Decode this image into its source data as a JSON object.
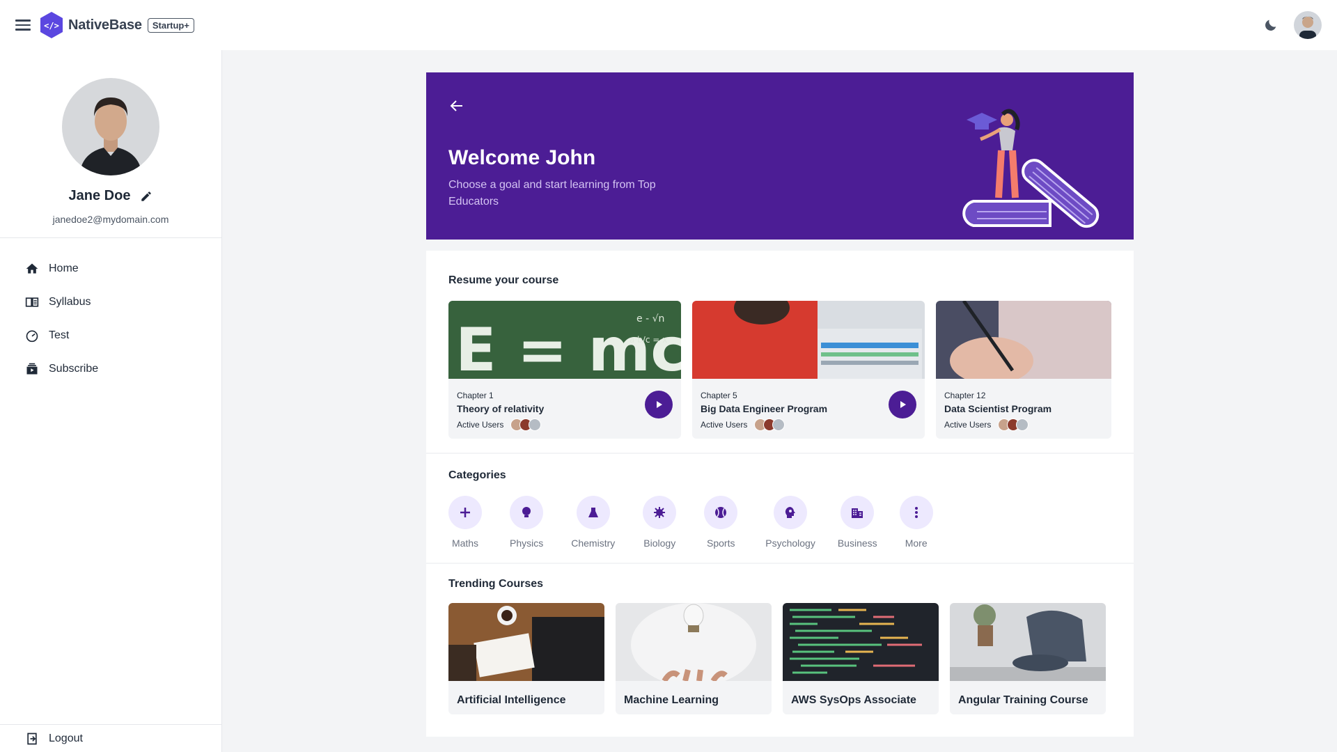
{
  "app": {
    "brand": "NativeBase",
    "badge": "Startup+"
  },
  "user": {
    "name": "Jane Doe",
    "email": "janedoe2@mydomain.com"
  },
  "sidebar": {
    "items": [
      {
        "label": "Home",
        "icon": "home-icon"
      },
      {
        "label": "Syllabus",
        "icon": "book-icon"
      },
      {
        "label": "Test",
        "icon": "speedometer-icon"
      },
      {
        "label": "Subscribe",
        "icon": "subscribe-icon"
      }
    ],
    "logout": "Logout"
  },
  "hero": {
    "title": "Welcome John",
    "subtitle": "Choose a goal and start learning from Top Educators"
  },
  "resume": {
    "title": "Resume your course",
    "courses": [
      {
        "chapter": "Chapter 1",
        "title": "Theory of relativity",
        "active_label": "Active Users"
      },
      {
        "chapter": "Chapter 5",
        "title": "Big Data Engineer Program",
        "active_label": "Active Users"
      },
      {
        "chapter": "Chapter 12",
        "title": "Data Scientist Program",
        "active_label": "Active Users"
      }
    ]
  },
  "categories": {
    "title": "Categories",
    "items": [
      {
        "label": "Maths",
        "icon": "plus-icon"
      },
      {
        "label": "Physics",
        "icon": "lightbulb-icon"
      },
      {
        "label": "Chemistry",
        "icon": "flask-icon"
      },
      {
        "label": "Biology",
        "icon": "virus-icon"
      },
      {
        "label": "Sports",
        "icon": "baseball-icon"
      },
      {
        "label": "Psychology",
        "icon": "brain-icon"
      },
      {
        "label": "Business",
        "icon": "building-icon"
      },
      {
        "label": "More",
        "icon": "more-vertical-icon"
      }
    ]
  },
  "trending": {
    "title": "Trending Courses",
    "items": [
      {
        "label": "Artificial Intelligence"
      },
      {
        "label": "Machine Learning"
      },
      {
        "label": "AWS SysOps Associate"
      },
      {
        "label": "Angular Training Course"
      }
    ]
  },
  "colors": {
    "primary": "#4c1d95",
    "accent_light": "#ede9fe",
    "background": "#f3f4f6"
  }
}
